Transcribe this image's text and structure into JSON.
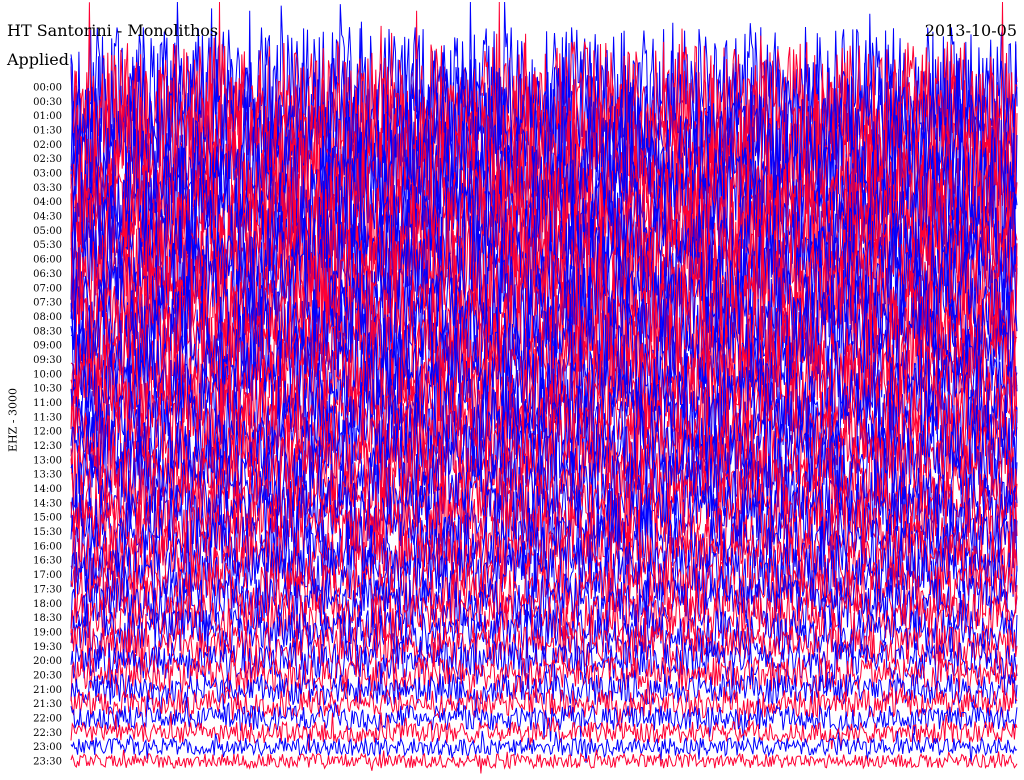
{
  "header": {
    "station": "HT Santorini - Monolithos",
    "date": "2013-10-05",
    "filter": "Applied"
  },
  "channel_label": "EHZ - 3000",
  "colors": {
    "trace_a": "#0000ff",
    "trace_b": "#ff0033",
    "background": "#ffffff",
    "text": "#000000"
  },
  "chart_data": {
    "type": "line",
    "title": "HT Santorini - Monolithos",
    "date": "2013-10-05",
    "ylabel": "EHZ - 3000",
    "y_tick_labels": [
      "00:00",
      "00:30",
      "01:00",
      "01:30",
      "02:00",
      "02:30",
      "03:00",
      "03:30",
      "04:00",
      "04:30",
      "05:00",
      "05:30",
      "06:00",
      "06:30",
      "07:00",
      "07:30",
      "08:00",
      "08:30",
      "09:00",
      "09:30",
      "10:00",
      "10:30",
      "11:00",
      "11:30",
      "12:00",
      "12:30",
      "13:00",
      "13:30",
      "14:00",
      "14:30",
      "15:00",
      "15:30",
      "16:00",
      "16:30",
      "17:00",
      "17:30",
      "18:00",
      "18:30",
      "19:00",
      "19:30",
      "20:00",
      "20:30",
      "21:00",
      "21:30",
      "22:00",
      "22:30",
      "23:00",
      "23:30"
    ],
    "trace_color_sequence": [
      "#0000ff",
      "#ff0033"
    ],
    "grid": false
  }
}
